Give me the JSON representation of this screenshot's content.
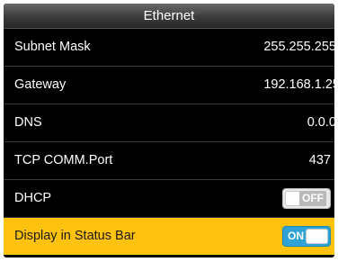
{
  "header": {
    "title": "Ethernet"
  },
  "rows": [
    {
      "label": "Subnet Mask",
      "value": "255.255.255."
    },
    {
      "label": "Gateway",
      "value": "192.168.1.25"
    },
    {
      "label": "DNS",
      "value": "0.0.0."
    },
    {
      "label": "TCP COMM.Port",
      "value": "437"
    },
    {
      "label": "DHCP",
      "toggle": "OFF"
    },
    {
      "label": "Display in Status Bar",
      "toggle": "ON"
    }
  ],
  "colors": {
    "highlight": "#ffc20e",
    "toggle_on": "#2fa3d6",
    "toggle_off": "#e9e9e9"
  }
}
